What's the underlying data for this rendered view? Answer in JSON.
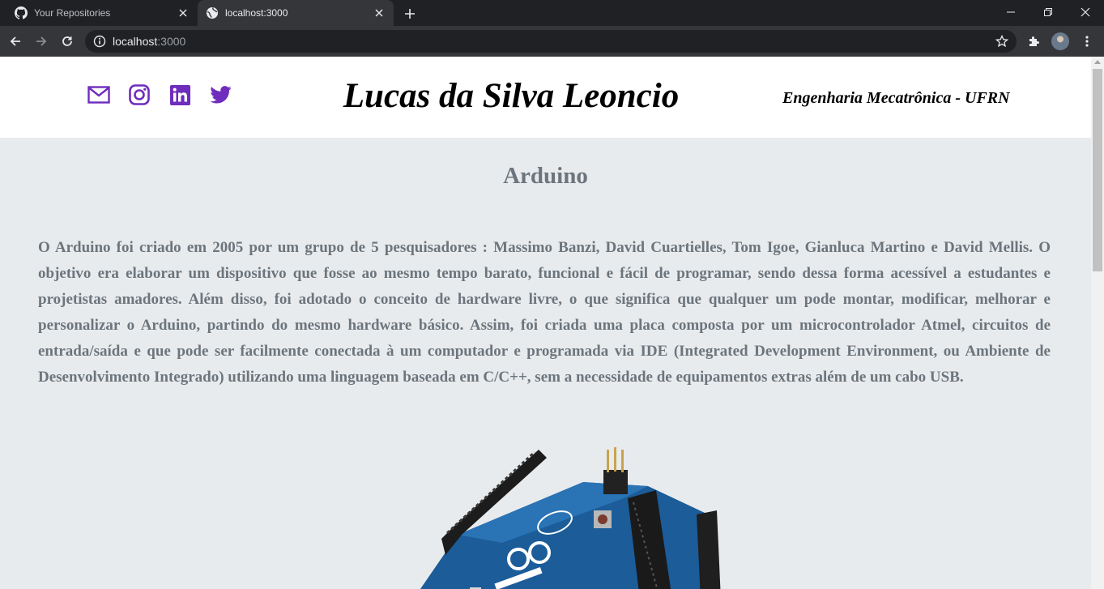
{
  "browser": {
    "tabs": [
      {
        "title": "Your Repositories",
        "icon": "github-icon",
        "active": false
      },
      {
        "title": "localhost:3000",
        "icon": "globe-icon",
        "active": true
      }
    ],
    "address": {
      "host": "localhost",
      "port": ":3000"
    }
  },
  "header": {
    "social": [
      {
        "name": "email-icon",
        "color": "#6f2dbd"
      },
      {
        "name": "instagram-icon",
        "color": "#6f2dbd"
      },
      {
        "name": "linkedin-icon",
        "color": "#6f2dbd"
      },
      {
        "name": "twitter-icon",
        "color": "#6f2dbd"
      }
    ],
    "title": "Lucas da Silva Leoncio",
    "subtitle": "Engenharia Mecatrônica - UFRN"
  },
  "content": {
    "heading": "Arduino",
    "paragraph": "O Arduino foi criado em 2005 por um grupo de 5 pesquisadores : Massimo Banzi, David Cuartielles, Tom Igoe, Gianluca Martino e David Mellis. O objetivo era elaborar um dispositivo que fosse ao mesmo tempo barato, funcional e fácil de programar, sendo dessa forma acessível a estudantes e projetistas amadores. Além disso, foi adotado o conceito de hardware livre, o que significa que qualquer um pode montar, modificar, melhorar e personalizar o Arduino, partindo do mesmo hardware básico. Assim, foi criada uma placa composta por um microcontrolador Atmel, circuitos de entrada/saída e que pode ser facilmente conectada à um computador e programada via IDE (Integrated Development Environment, ou Ambiente de Desenvolvimento Integrado) utilizando uma linguagem baseada em C/C++, sem a necessidade de equipamentos extras além de um cabo USB.",
    "image": {
      "subject": "arduino-uno-board"
    }
  },
  "colors": {
    "accent": "#6f2dbd",
    "page_bg": "#e8ebed",
    "text_muted": "#6c757d"
  }
}
